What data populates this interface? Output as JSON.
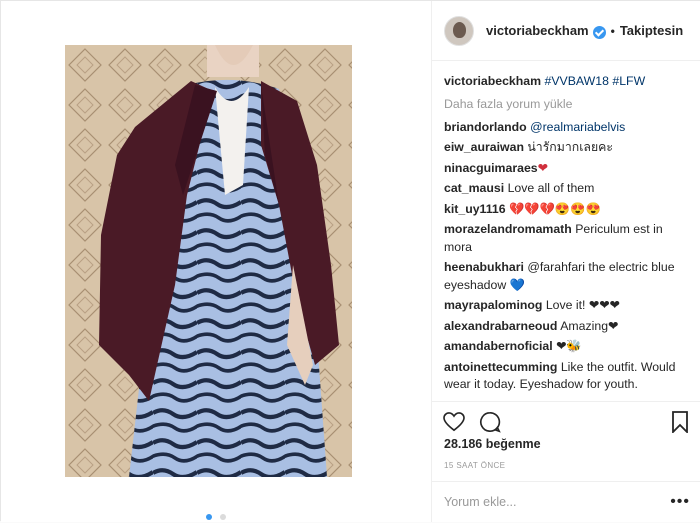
{
  "post": {
    "username": "victoriabeckham",
    "separator": "•",
    "follow_label": "Takiptesin",
    "caption_user": "victoriabeckham",
    "caption_text": "#VVBAW18 #LFW",
    "load_more": "Daha fazla yorum yükle",
    "comments": [
      {
        "user": "briandorlando",
        "text": "@realmariabelvis"
      },
      {
        "user": "eiw_auraiwan",
        "text": "น่ารักมากเลยคะ"
      },
      {
        "user": "ninacguimaraes",
        "text": "❤"
      },
      {
        "user": "cat_mausi",
        "text": "Love all of them"
      },
      {
        "user": "kit_uy1116",
        "text": "💔💔💔😍😍😍"
      },
      {
        "user": "morazelandromamath",
        "text": "Periculum est in mora"
      },
      {
        "user": "heenabukhari",
        "text": "@farahfari the electric blue eyeshadow 💙"
      },
      {
        "user": "mayrapalominog",
        "text": "Love it! ❤❤❤"
      },
      {
        "user": "alexandrabarneoud",
        "text": "Amazing❤"
      },
      {
        "user": "amandabernoficial",
        "text": "❤🐝"
      },
      {
        "user": "antoinettecumming",
        "text": "Like the outfit. Would wear it today. Eyeshadow for youth."
      }
    ],
    "likes": "28.186 beğenme",
    "time_ago": "15 SAAT ÖNCE",
    "comment_placeholder": "Yorum ekle...",
    "more_label": "•••"
  },
  "icons": {
    "verified": "verified-badge-icon",
    "like": "heart-icon",
    "comment": "comment-bubble-icon",
    "save": "bookmark-icon"
  },
  "colors": {
    "link": "#003569",
    "verified": "#3897f0",
    "muted": "#999999",
    "jacket": "#4a1a26",
    "dress": "#9fb6dc"
  },
  "carousel": {
    "count": 2,
    "active": 1
  }
}
